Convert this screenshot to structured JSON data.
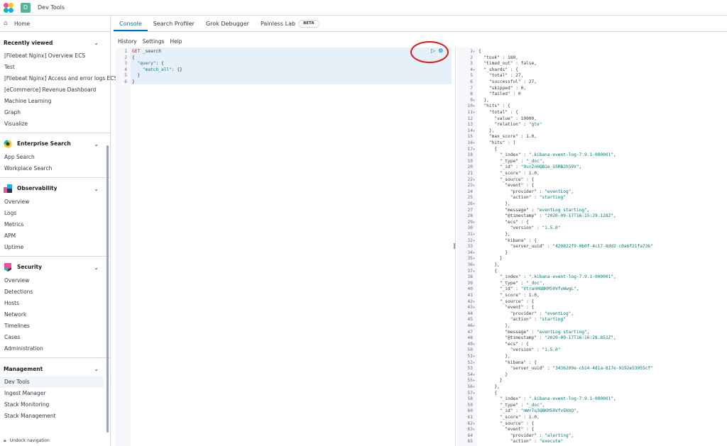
{
  "header": {
    "space_initial": "D",
    "title": "Dev Tools"
  },
  "sidebar": {
    "home": "Home",
    "recently_viewed": {
      "title": "Recently viewed",
      "items": [
        "[Filebeat Nginx] Overview ECS",
        "Test",
        "[Filebeat Nginx] Access and error logs ECS",
        "[eCommerce] Revenue Dashboard"
      ]
    },
    "kibana_items": [
      "Machine Learning",
      "Graph",
      "Visualize"
    ],
    "enterprise_search": {
      "title": "Enterprise Search",
      "items": [
        "App Search",
        "Workplace Search"
      ]
    },
    "observability": {
      "title": "Observability",
      "items": [
        "Overview",
        "Logs",
        "Metrics",
        "APM",
        "Uptime"
      ]
    },
    "security": {
      "title": "Security",
      "items": [
        "Overview",
        "Detections",
        "Hosts",
        "Network",
        "Timelines",
        "Cases",
        "Administration"
      ]
    },
    "management": {
      "title": "Management",
      "items": [
        "Dev Tools",
        "Ingest Manager",
        "Stack Monitoring",
        "Stack Management"
      ]
    },
    "unlock": "Undock navigation"
  },
  "tabs": [
    {
      "label": "Console"
    },
    {
      "label": "Search Profiler"
    },
    {
      "label": "Grok Debugger"
    },
    {
      "label": "Painless Lab"
    }
  ],
  "beta_badge": "BETA",
  "subnav": [
    "History",
    "Settings",
    "Help"
  ],
  "request": [
    {
      "n": "1",
      "parts": [
        [
          "m",
          "GET"
        ],
        [
          "p",
          " _search"
        ]
      ]
    },
    {
      "n": "2",
      "fold": true,
      "parts": [
        [
          "p",
          "{"
        ]
      ]
    },
    {
      "n": "3",
      "fold": true,
      "parts": [
        [
          "p",
          "  "
        ],
        [
          "s",
          "\"query\""
        ],
        [
          "p",
          ": {"
        ]
      ]
    },
    {
      "n": "4",
      "parts": [
        [
          "p",
          "    "
        ],
        [
          "s",
          "\"match_all\""
        ],
        [
          "p",
          ": {}"
        ]
      ]
    },
    {
      "n": "5",
      "fold": true,
      "parts": [
        [
          "p",
          "  }"
        ]
      ]
    },
    {
      "n": "6",
      "fold": true,
      "parts": [
        [
          "p",
          "}"
        ]
      ]
    }
  ],
  "response": [
    {
      "n": "1",
      "fold": true,
      "t": "{"
    },
    {
      "n": "2",
      "t": "  \"took\" : 180,"
    },
    {
      "n": "3",
      "t": "  \"timed_out\" : false,"
    },
    {
      "n": "4",
      "fold": true,
      "t": "  \"_shards\" : {"
    },
    {
      "n": "5",
      "t": "    \"total\" : 27,"
    },
    {
      "n": "6",
      "t": "    \"successful\" : 27,"
    },
    {
      "n": "7",
      "t": "    \"skipped\" : 0,"
    },
    {
      "n": "8",
      "t": "    \"failed\" : 0"
    },
    {
      "n": "9",
      "fold": true,
      "t": "  },"
    },
    {
      "n": "10",
      "fold": true,
      "t": "  \"hits\" : {"
    },
    {
      "n": "11",
      "fold": true,
      "t": "    \"total\" : {"
    },
    {
      "n": "12",
      "t": "      \"value\" : 10000,"
    },
    {
      "n": "13",
      "t": "      \"relation\" : \"gte\""
    },
    {
      "n": "14",
      "fold": true,
      "t": "    },"
    },
    {
      "n": "15",
      "t": "    \"max_score\" : 1.0,"
    },
    {
      "n": "16",
      "fold": true,
      "t": "    \"hits\" : ["
    },
    {
      "n": "17",
      "fold": true,
      "t": "      {"
    },
    {
      "n": "18",
      "t": "        \"_index\" : \".kibana-event-log-7.9.1-000001\","
    },
    {
      "n": "19",
      "t": "        \"_type\" : \"_doc\","
    },
    {
      "n": "20",
      "t": "        \"_id\" : \"9urZnHQB1e_G5RB2h59V\","
    },
    {
      "n": "21",
      "t": "        \"_score\" : 1.0,"
    },
    {
      "n": "22",
      "fold": true,
      "t": "        \"_source\" : {"
    },
    {
      "n": "23",
      "fold": true,
      "t": "          \"event\" : {"
    },
    {
      "n": "24",
      "t": "            \"provider\" : \"eventLog\","
    },
    {
      "n": "25",
      "t": "            \"action\" : \"starting\""
    },
    {
      "n": "26",
      "fold": true,
      "t": "          },"
    },
    {
      "n": "27",
      "t": "          \"message\" : \"eventLog starting\","
    },
    {
      "n": "28",
      "t": "          \"@timestamp\" : \"2020-09-17T16:15:29.128Z\","
    },
    {
      "n": "29",
      "fold": true,
      "t": "          \"ecs\" : {"
    },
    {
      "n": "30",
      "t": "            \"version\" : \"1.5.0\""
    },
    {
      "n": "31",
      "fold": true,
      "t": "          },"
    },
    {
      "n": "32",
      "fold": true,
      "t": "          \"kibana\" : {"
    },
    {
      "n": "33",
      "t": "            \"server_uuid\" : \"420822f9-0b0f-4c17-8dd2-c0a6f21fa736\""
    },
    {
      "n": "34",
      "fold": true,
      "t": "          }"
    },
    {
      "n": "35",
      "fold": true,
      "t": "        }"
    },
    {
      "n": "36",
      "fold": true,
      "t": "      },"
    },
    {
      "n": "37",
      "fold": true,
      "t": "      {"
    },
    {
      "n": "38",
      "t": "        \"_index\" : \".kibana-event-log-7.9.1-000001\","
    },
    {
      "n": "39",
      "t": "        \"_type\" : \"_doc\","
    },
    {
      "n": "40",
      "t": "        \"_id\" : \"VtranHQBKM50VfvWwgL\","
    },
    {
      "n": "41",
      "t": "        \"_score\" : 1.0,"
    },
    {
      "n": "42",
      "fold": true,
      "t": "        \"_source\" : {"
    },
    {
      "n": "43",
      "fold": true,
      "t": "          \"event\" : {"
    },
    {
      "n": "44",
      "t": "            \"provider\" : \"eventLog\","
    },
    {
      "n": "45",
      "t": "            \"action\" : \"starting\""
    },
    {
      "n": "46",
      "fold": true,
      "t": "          },"
    },
    {
      "n": "47",
      "t": "          \"message\" : \"eventLog starting\","
    },
    {
      "n": "48",
      "t": "          \"@timestamp\" : \"2020-09-17T16:16:28.852Z\","
    },
    {
      "n": "49",
      "fold": true,
      "t": "          \"ecs\" : {"
    },
    {
      "n": "50",
      "t": "            \"version\" : \"1.5.0\""
    },
    {
      "n": "51",
      "fold": true,
      "t": "          },"
    },
    {
      "n": "52",
      "fold": true,
      "t": "          \"kibana\" : {"
    },
    {
      "n": "53",
      "t": "            \"server_uuid\" : \"3436209e-cb14-4d1a-817e-9192e53955cf\""
    },
    {
      "n": "54",
      "fold": true,
      "t": "          }"
    },
    {
      "n": "55",
      "fold": true,
      "t": "        }"
    },
    {
      "n": "56",
      "fold": true,
      "t": "      },"
    },
    {
      "n": "57",
      "fold": true,
      "t": "      {"
    },
    {
      "n": "58",
      "t": "        \"_index\" : \".kibana-event-log-7.9.1-000001\","
    },
    {
      "n": "59",
      "t": "        \"_type\" : \"_doc\","
    },
    {
      "n": "60",
      "t": "        \"_id\" : \"mWr7q3QBKM50VfvENXQ\","
    },
    {
      "n": "61",
      "t": "        \"_score\" : 1.0,"
    },
    {
      "n": "62",
      "fold": true,
      "t": "        \"_source\" : {"
    },
    {
      "n": "63",
      "fold": true,
      "t": "          \"event\" : {"
    },
    {
      "n": "64",
      "t": "            \"provider\" : \"alerting\","
    },
    {
      "n": "65",
      "t": "            \"action\" : \"execute\""
    }
  ],
  "colors": {
    "accent": "#006bb8",
    "annotation_circle": "#e3151a",
    "string": "#017d73",
    "method": "#bd271e"
  }
}
